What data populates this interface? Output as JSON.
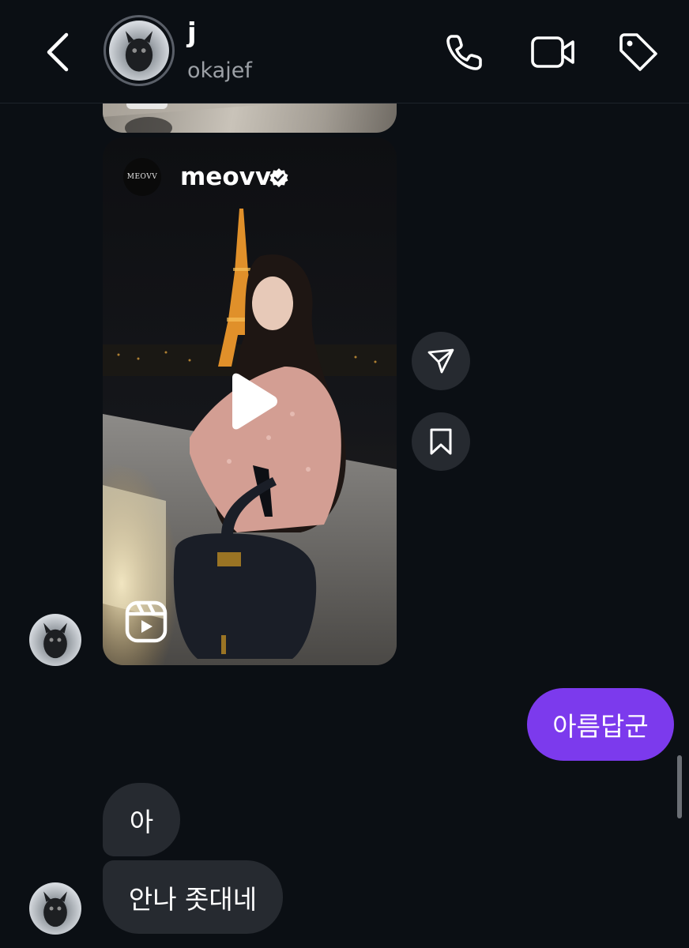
{
  "header": {
    "name": "j",
    "username": "okajef",
    "icons": [
      "back-chevron-icon",
      "phone-icon",
      "video-camera-icon",
      "tag-icon"
    ]
  },
  "reel": {
    "account_logo": "MEOVV",
    "account_name": "meovv",
    "verified_icon": "verified-badge-icon",
    "play_icon": "play-icon",
    "type_icon": "reels-icon",
    "actions": [
      "share-send-icon",
      "save-bookmark-icon"
    ]
  },
  "messages": [
    {
      "direction": "outgoing",
      "text": "아름답군"
    },
    {
      "direction": "incoming",
      "text": "아"
    },
    {
      "direction": "incoming",
      "text": "안나 좃대네"
    }
  ],
  "colors": {
    "background": "#0b0f14",
    "outgoing_bubble": "#7c3aed",
    "incoming_bubble": "#262a30",
    "secondary_text": "#9ca0a6"
  }
}
